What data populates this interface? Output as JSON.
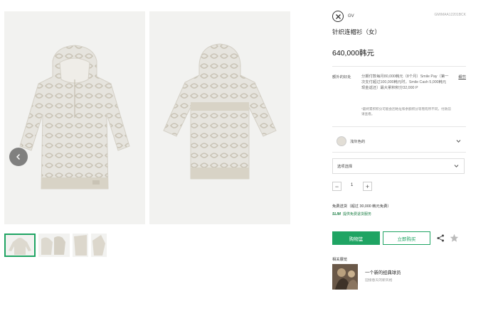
{
  "product": {
    "sku": "GMIMAA12201BCK",
    "brand_name": "GV",
    "title": "针织连帽衫（女）",
    "price": "640,000韩元"
  },
  "benefits": {
    "label": "额外的好处",
    "text": "分期付款每月80,000韩元（8个月）Smile Pay（第一次支付超过100,000韩元时，Smile Cash 5,000韩元现金返还）最大累积积分32,000 P",
    "link": "细节",
    "note": "*最终累积积分可能会因地址和余额积分等而有所不同，付款前请查看。"
  },
  "color_option": {
    "label": "浅灰色的",
    "icon": "chevron-down-icon"
  },
  "size_option": {
    "label": "选项选择",
    "icon": "chevron-down-icon"
  },
  "quantity": {
    "value": "1",
    "minus": "−",
    "plus": "+"
  },
  "shipping": {
    "title": "免费送货（超过 30,000 韩元免费）",
    "badge": "SLIM",
    "link": "提供免费退货服务"
  },
  "actions": {
    "cart": "购物篮",
    "buy": "立即购买",
    "share_icon": "share-icon",
    "wish_icon": "star-icon"
  },
  "related": {
    "title": "相关展览",
    "name": "一个新的经典球员",
    "sub": "迎接春天的新风格"
  },
  "colors": {
    "accent": "#1fa463",
    "knit": "#e4e2dc",
    "pattern": "#c8c2b4"
  }
}
